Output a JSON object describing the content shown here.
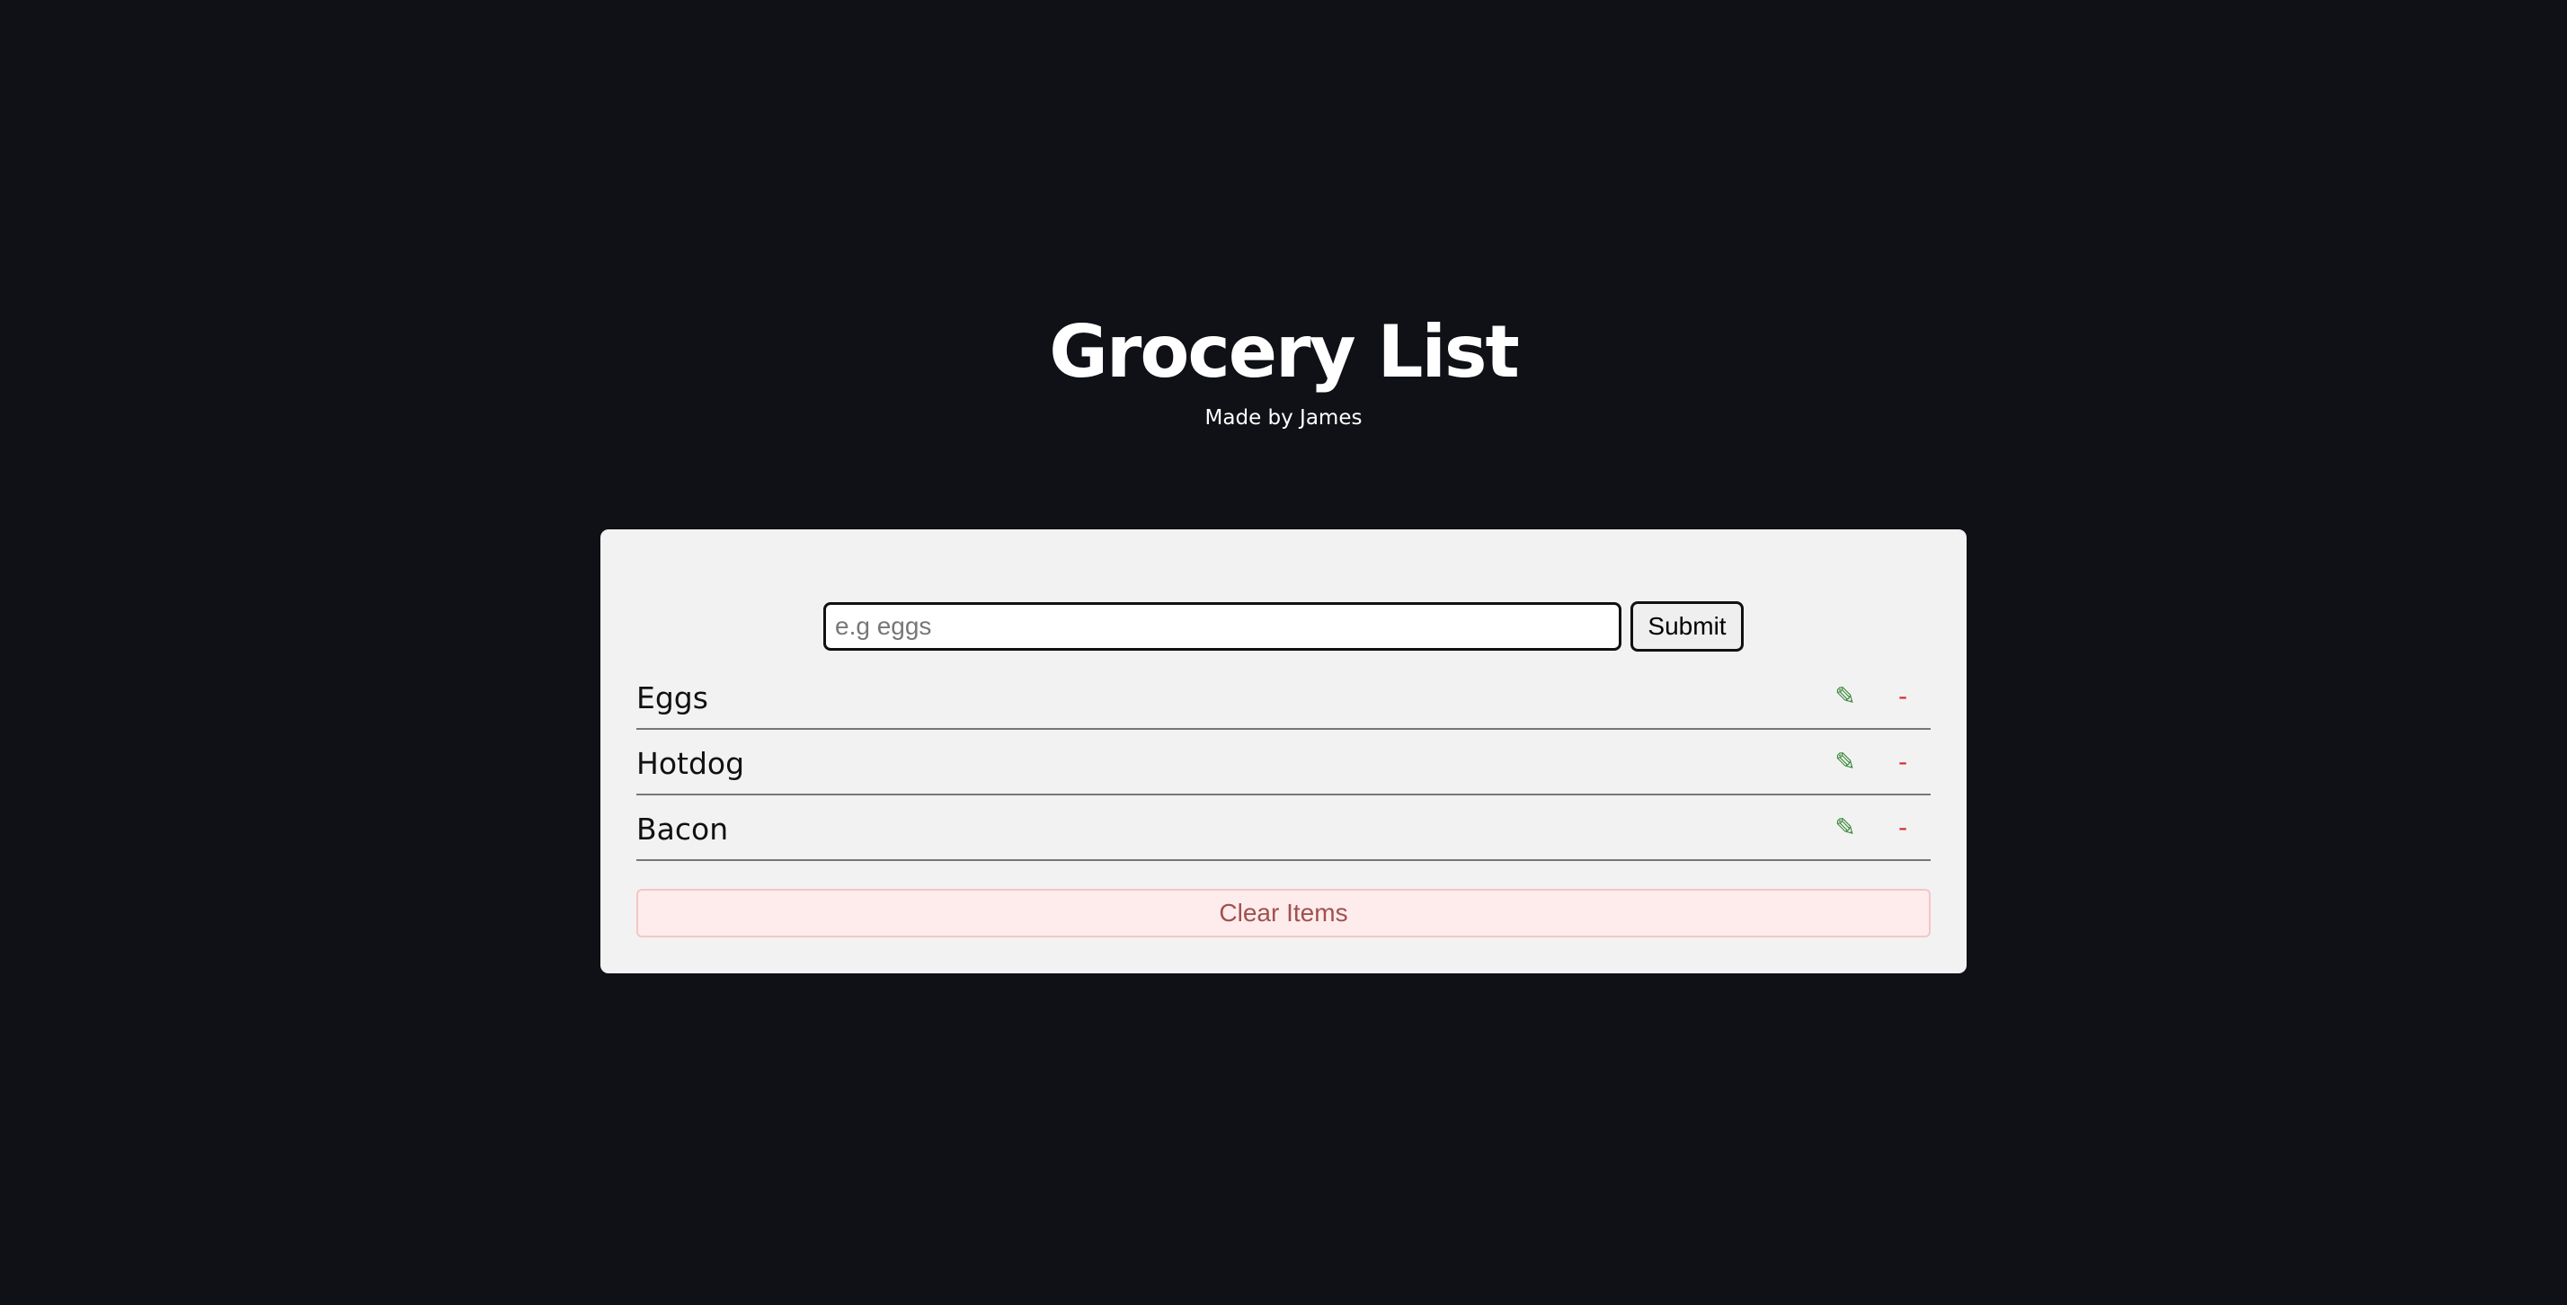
{
  "header": {
    "title": "Grocery List",
    "subtitle": "Made by James"
  },
  "form": {
    "placeholder": "e.g eggs",
    "value": "",
    "submit_label": "Submit"
  },
  "items": [
    {
      "name": "Eggs",
      "edit_icon": "✎",
      "delete_icon": "-"
    },
    {
      "name": "Hotdog",
      "edit_icon": "✎",
      "delete_icon": "-"
    },
    {
      "name": "Bacon",
      "edit_icon": "✎",
      "delete_icon": "-"
    }
  ],
  "clear_label": "Clear Items",
  "colors": {
    "background": "#0f1117",
    "card": "#f2f2f2",
    "edit": "#3c8a3c",
    "delete": "#d32f2f",
    "clear_bg": "#fdeceb",
    "clear_text": "#a15050"
  }
}
